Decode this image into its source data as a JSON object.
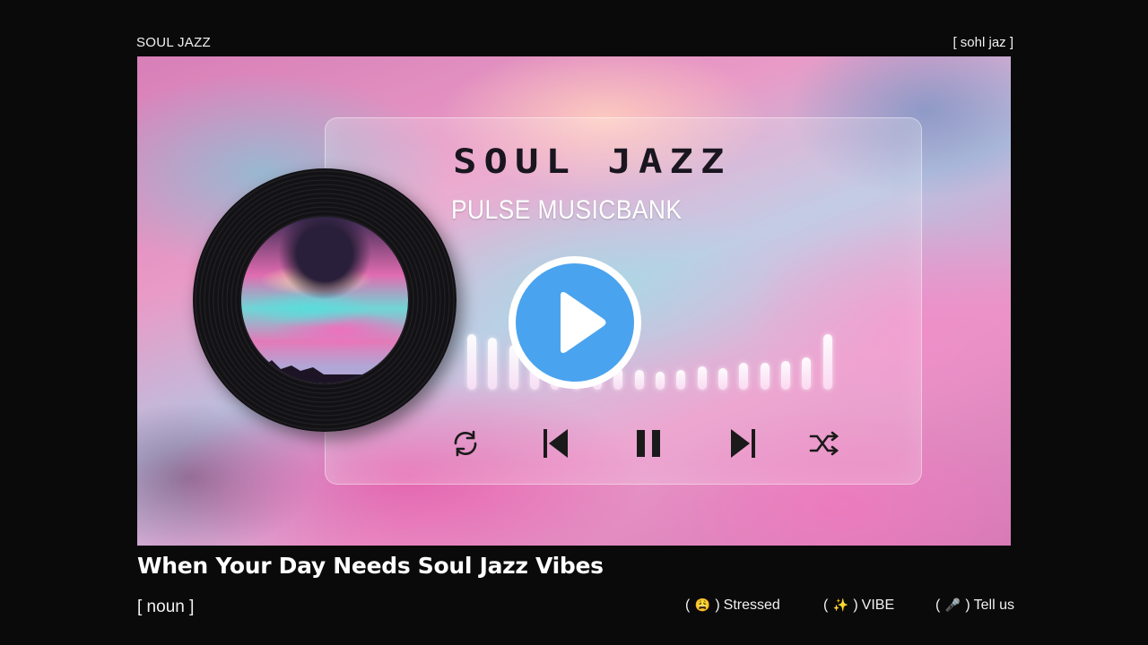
{
  "header": {
    "left_label": "SOUL JAZZ",
    "right_label": "[ sohl jaz ]"
  },
  "artwork": {
    "logo_text": "SOUL JAZZ",
    "subtitle": "PULSE MUSICBANK",
    "colors": {
      "play_button": "#4aa3ee",
      "background_pink": "#e99ac6",
      "background_teal": "#82dce1"
    },
    "equalizer_levels": [
      0.62,
      0.58,
      0.5,
      0.45,
      0.3,
      0.26,
      0.22,
      0.24,
      0.22,
      0.2,
      0.22,
      0.26,
      0.24,
      0.3,
      0.3,
      0.32,
      0.36,
      0.62
    ]
  },
  "player": {
    "icons": [
      "repeat-icon",
      "skip-previous-icon",
      "pause-icon",
      "skip-next-icon",
      "shuffle-icon",
      "play-icon"
    ]
  },
  "footer": {
    "headline": "When Your Day Needs Soul Jazz Vibes",
    "part_of_speech": "[ noun ]",
    "chips": [
      {
        "emoji": "😩",
        "label": "Stressed"
      },
      {
        "emoji": "✨",
        "label": "VIBE"
      },
      {
        "emoji": "🎤",
        "label": "Tell us"
      }
    ]
  }
}
